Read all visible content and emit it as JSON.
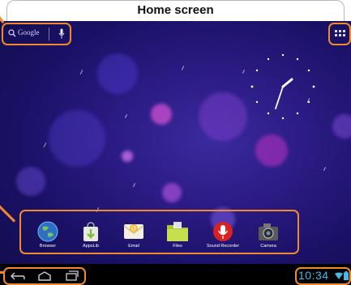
{
  "title": "Home screen",
  "search": {
    "google_label": "Google"
  },
  "dock": {
    "items": [
      {
        "label": "Browser",
        "icon": "globe-icon"
      },
      {
        "label": "AppsLib",
        "icon": "shopping-bag-icon"
      },
      {
        "label": "Email",
        "icon": "envelope-icon"
      },
      {
        "label": "Files",
        "icon": "folder-icon"
      },
      {
        "label": "Sound Recorder",
        "icon": "microphone-icon"
      },
      {
        "label": "Camera",
        "icon": "camera-icon"
      }
    ]
  },
  "status": {
    "time": "10:34"
  },
  "colors": {
    "highlight": "#f08a2d",
    "time": "#4ab7e6",
    "wallpaper": "#2a1a82"
  }
}
